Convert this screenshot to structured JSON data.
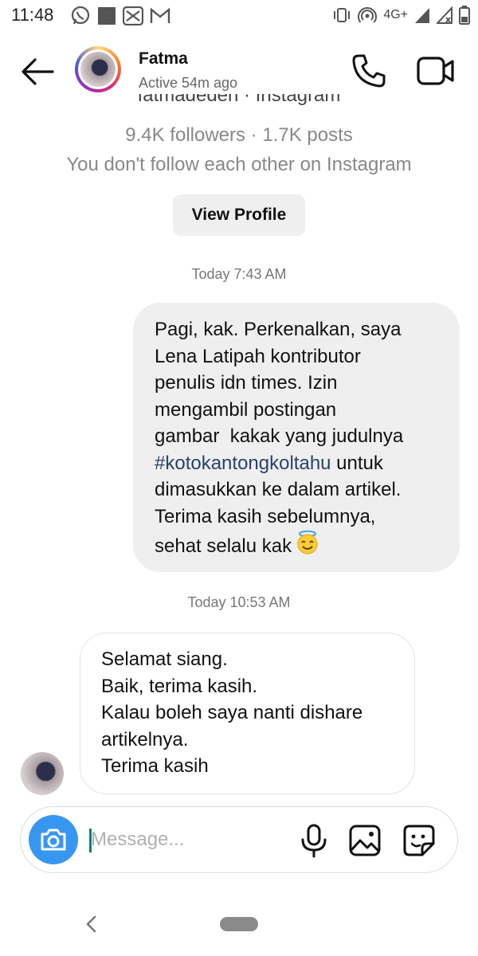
{
  "status_bar": {
    "time": "11:48",
    "network": "4G+",
    "icons_left": [
      "whatsapp-icon",
      "gallery-notification-icon",
      "email-notification-icon",
      "gmail-icon"
    ],
    "icons_right": [
      "vibrate-icon",
      "hotspot-icon",
      "signal-icon",
      "signal-icon",
      "battery-icon"
    ]
  },
  "header": {
    "name": "Fatma",
    "status": "Active 54m ago"
  },
  "profile": {
    "username_line": "fatmadeden · Instagram",
    "followers_line": "9.4K followers · 1.7K posts",
    "follow_status": "You don't follow each other on Instagram",
    "view_profile_label": "View Profile"
  },
  "conversation": {
    "timestamp_1": "Today 7:43 AM",
    "sent_message": {
      "before_hashtag": "Pagi, kak. Perkenalkan, saya\nLena Latipah kontributor\npenulis idn times. Izin\nmengambil postingan\ngambar  kakak yang judulnya\n",
      "hashtag": "#kotokantongkoltahu",
      "after_hashtag": " untuk\ndimasukkan ke dalam artikel.\nTerima kasih sebelumnya,\nsehat selalu kak"
    },
    "timestamp_2": "Today 10:53 AM",
    "received_message": "Selamat siang.\nBaik, terima kasih.\nKalau boleh saya nanti dishare\nartikelnya.\nTerima kasih"
  },
  "composer": {
    "placeholder": "Message...",
    "value": ""
  },
  "colors": {
    "accent_blue": "#3797f0",
    "outgoing_bubble": "#efefef",
    "hashtag": "#27436e",
    "muted_text": "#888888"
  }
}
